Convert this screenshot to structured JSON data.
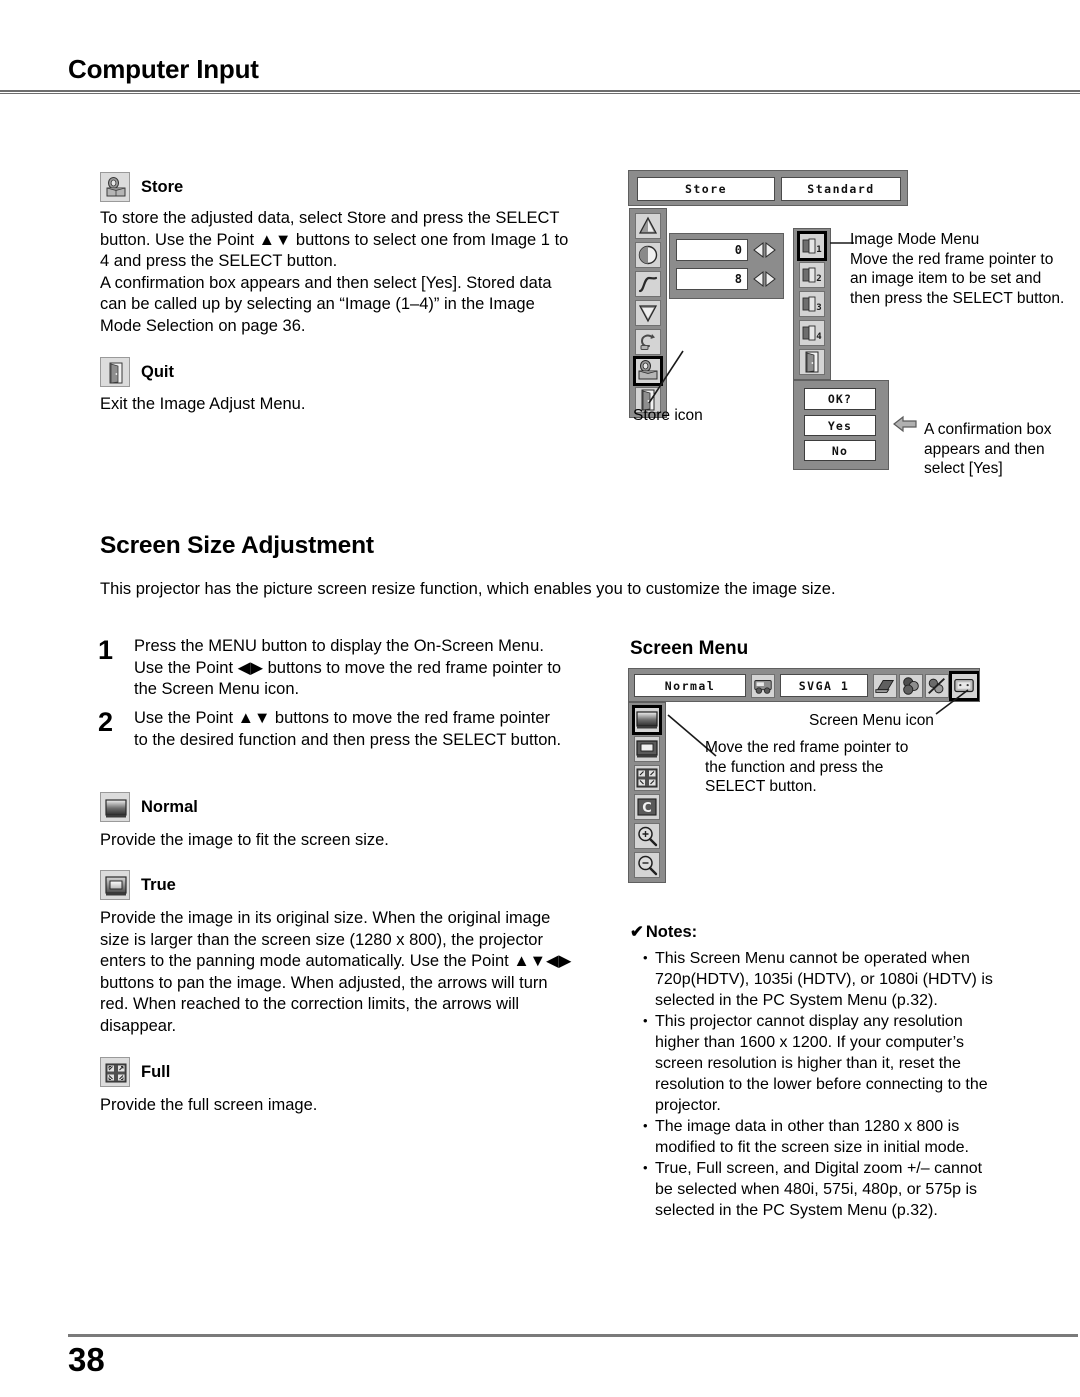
{
  "header": {
    "title": "Computer Input"
  },
  "footer": {
    "page_number": "38"
  },
  "store_section": {
    "icon": "store-icon",
    "heading": "Store",
    "body": "To store the adjusted data, select Store and press the SELECT button. Use the Point ▲▼ buttons to select one from Image 1 to 4 and press the SELECT button.\nA confirmation box appears and then select [Yes]. Stored data can be called up by selecting an “Image (1–4)” in the Image Mode Selection on page 36."
  },
  "quit_section": {
    "icon": "quit-door-icon",
    "heading": "Quit",
    "body": "Exit the Image Adjust Menu."
  },
  "image_adjust_osd": {
    "tab_store": "Store",
    "tab_standard": "Standard",
    "value_top": "0",
    "value_bottom": "8",
    "left_icons": [
      "contrast-triangle-icon",
      "brightness-circle-icon",
      "gamma-curve-icon",
      "color-temp-icon",
      "reset-icon",
      "store-icon",
      "quit-door-icon"
    ],
    "selected_left_icon_index": 5,
    "store_icon_label": "Store icon",
    "image_mode_items": [
      "1",
      "2",
      "3",
      "4",
      "quit"
    ],
    "image_mode_selected_index": 0,
    "image_mode_callout": "Image Mode Menu\nMove the red frame pointer to an image item to be set and then press the SELECT button.",
    "confirm_box": {
      "prompt": "OK?",
      "yes": "Yes",
      "no": "No"
    },
    "confirm_callout": "A confirmation box appears and then select [Yes]"
  },
  "screen_size_section": {
    "title": "Screen Size Adjustment",
    "intro": "This projector has the picture screen resize function, which enables you to customize the image size.",
    "steps": [
      {
        "number": "1",
        "text": "Press the MENU button to display the On-Screen Menu. Use the Point ◀▶ buttons to move the red frame pointer to the Screen Menu icon."
      },
      {
        "number": "2",
        "text": "Use the Point ▲▼ buttons to move the red frame pointer to the desired function and then press the SELECT button."
      }
    ],
    "items": [
      {
        "icon": "screen-normal-icon",
        "heading": "Normal",
        "body": "Provide the image to fit the screen size."
      },
      {
        "icon": "screen-true-icon",
        "heading": "True",
        "body": "Provide the image in its original size. When the original image size is larger than the screen size (1280 x 800), the projector enters to the panning mode automatically. Use the Point ▲▼◀▶ buttons to pan the image. When adjusted, the arrows will turn red. When reached to the correction limits, the arrows will disappear."
      },
      {
        "icon": "screen-full-icon",
        "heading": "Full",
        "body": "Provide the full screen image."
      }
    ]
  },
  "screen_menu_diagram": {
    "title": "Screen Menu",
    "selected_label": "Normal",
    "system_label": "SVGA 1",
    "top_icons": [
      "input-source-icon",
      "pc-adjust-icon",
      "image-select-icon",
      "image-adjust-icon",
      "screen-menu-icon",
      "sound-icon",
      "setting-pencil-icon",
      "information-icon"
    ],
    "selected_top_icon_index": 4,
    "screen_menu_icon_label": "Screen Menu icon",
    "left_icons": [
      "screen-normal-icon",
      "screen-true-icon",
      "screen-full-icon",
      "custom-c-icon",
      "digital-zoom-in-icon",
      "digital-zoom-out-icon"
    ],
    "selected_left_icon_index": 0,
    "callout": "Move the red frame pointer to the function and press the SELECT button."
  },
  "notes": {
    "check_mark": "✔",
    "title": "Notes:",
    "items": [
      "This Screen Menu cannot be operated when 720p(HDTV), 1035i (HDTV), or 1080i (HDTV) is selected in the PC System Menu (p.32).",
      "This projector cannot display any resolution higher than 1600 x 1200. If your computer’s screen resolution is higher than it, reset the resolution to the lower before connecting to the projector.",
      "The image data in other than 1280 x 800 is modified to fit the screen size in initial mode.",
      "True, Full screen, and Digital zoom +/– cannot be selected when 480i, 575i, 480p, or 575p is selected in the PC System Menu (p.32)."
    ]
  },
  "colors": {
    "osd_panel": "#8c8c8c",
    "osd_field": "#ffffff",
    "icon_face": "#d4d4d4",
    "rule": "#6e6e6e"
  }
}
